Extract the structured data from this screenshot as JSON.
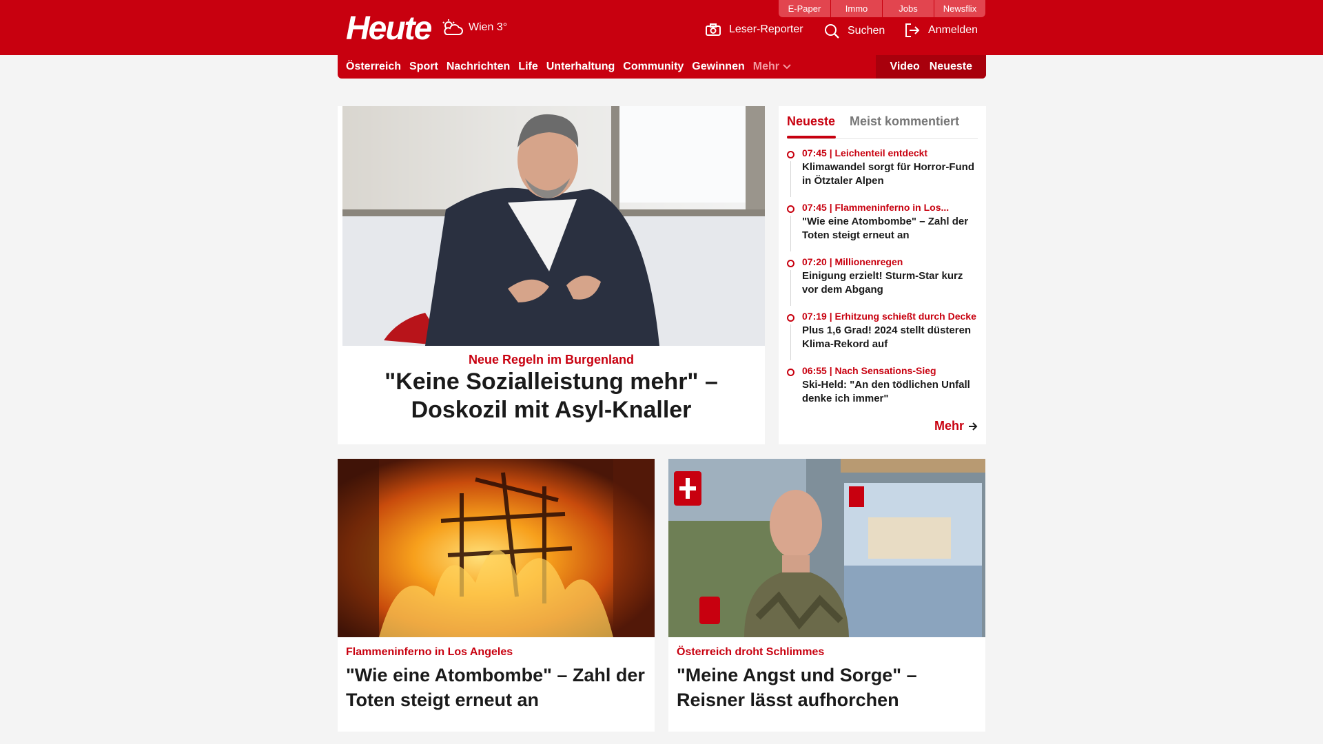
{
  "header": {
    "logo_text": "Heute",
    "weather": "Wien 3°",
    "top_links": [
      "E-Paper",
      "Immo",
      "Jobs",
      "Newsflix"
    ],
    "leser_reporter": "Leser-Reporter",
    "search": "Suchen",
    "login": "Anmelden"
  },
  "nav": {
    "items": [
      "Österreich",
      "Sport",
      "Nachrichten",
      "Life",
      "Unterhaltung",
      "Community",
      "Gewinnen"
    ],
    "more": "Mehr",
    "video": "Video",
    "neueste": "Neueste"
  },
  "hero": {
    "kicker": "Neue Regeln im Burgenland",
    "title": "\"Keine Sozialleistung mehr\" – Doskozil mit Asyl-Knaller"
  },
  "sidebar": {
    "tabs": [
      "Neueste",
      "Meist kommentiert"
    ],
    "items": [
      {
        "meta": "07:45 | Leichenteil entdeckt",
        "title": "Klimawandel sorgt für Horror-Fund in Ötztaler Alpen"
      },
      {
        "meta": "07:45 | Flammeninferno in Los...",
        "title": "\"Wie eine Atombombe\" – Zahl der Toten steigt erneut an"
      },
      {
        "meta": "07:20 | Millionenregen",
        "title": "Einigung erzielt! Sturm-Star kurz vor dem Abgang"
      },
      {
        "meta": "07:19 | Erhitzung schießt durch Decke",
        "title": "Plus 1,6 Grad! 2024 stellt düsteren Klima-Rekord auf"
      },
      {
        "meta": "06:55 | Nach Sensations-Sieg",
        "title": "Ski-Held: \"An den tödlichen Unfall denke ich immer\""
      }
    ],
    "more": "Mehr"
  },
  "cards": [
    {
      "kicker": "Flammeninferno in Los Angeles",
      "title": "\"Wie eine Atombombe\" – Zahl der Toten steigt erneut an"
    },
    {
      "kicker": "Österreich droht Schlimmes",
      "title": "\"Meine Angst und Sorge\" – Reisner lässt aufhorchen"
    }
  ],
  "colors": {
    "brand": "#c8000f"
  }
}
